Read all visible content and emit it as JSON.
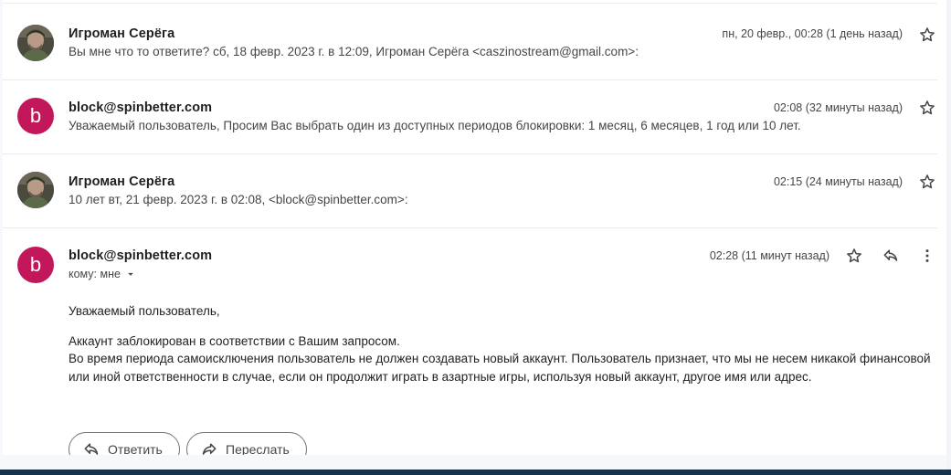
{
  "messages": [
    {
      "sender": "Игроман Серёга",
      "snippet": "Вы мне что то ответите? сб, 18 февр. 2023 г. в 12:09, Игроман Серёга <caszinostream@gmail.com>:",
      "date": "пн, 20 февр., 00:28 (1 день назад)",
      "avatar": "photo"
    },
    {
      "sender": "block@spinbetter.com",
      "snippet": "Уважаемый пользователь, Просим Вас выбрать один из доступных периодов блокировки: 1 месяц, 6 месяцев, 1 год или 10 лет.",
      "date": "02:08 (32 минуты назад)",
      "avatar": "b"
    },
    {
      "sender": "Игроман Серёга",
      "snippet": "10 лет вт, 21 февр. 2023 г. в 02:08, <block@spinbetter.com>:",
      "date": "02:15 (24 минуты назад)",
      "avatar": "photo"
    }
  ],
  "open_message": {
    "sender": "block@spinbetter.com",
    "avatar": "b",
    "date": "02:28 (11 минут назад)",
    "to": "кому: мне",
    "greeting": "Уважаемый пользователь,",
    "line1": "Аккаунт заблокирован в соответствии с Вашим запросом.",
    "line2": "Во время периода самоисключения пользователь не должен создавать новый аккаунт. Пользователь признает, что мы не несем никакой финансовой или иной ответственности в случае, если он продолжит играть в азартные игры, используя новый аккаунт, другое имя или адрес."
  },
  "actions": {
    "reply_label": "Ответить",
    "forward_label": "Переслать"
  },
  "colors": {
    "avatar_letter_bg": "#c2185b"
  }
}
